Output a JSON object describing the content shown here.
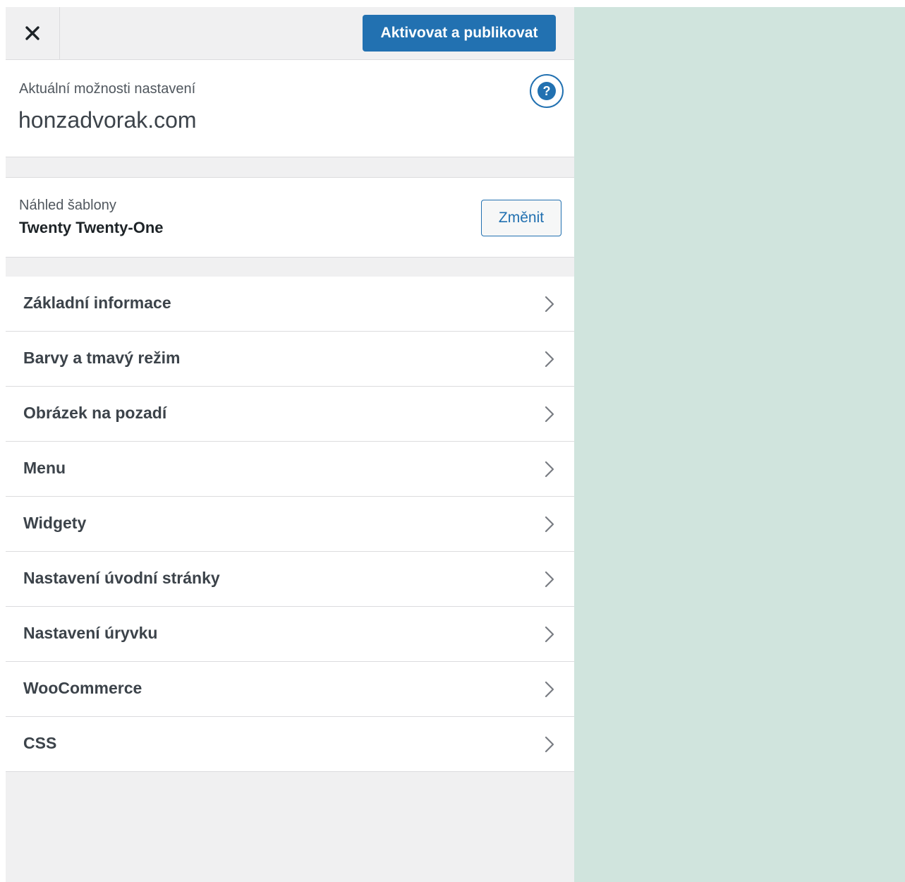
{
  "colors": {
    "accent": "#2271b1",
    "panel_bg": "#f0f0f1",
    "preview_bg": "#d0e4dd"
  },
  "header": {
    "close_icon": "close-icon",
    "publish_label": "Aktivovat a publikovat"
  },
  "info": {
    "label": "Aktuální možnosti nastavení",
    "site": "honzadvorak.com",
    "help_icon": "help-icon",
    "help_glyph": "?"
  },
  "theme": {
    "label": "Náhled šablony",
    "name": "Twenty Twenty-One",
    "change_label": "Změnit"
  },
  "menu": {
    "items": [
      {
        "label": "Základní informace"
      },
      {
        "label": "Barvy a tmavý režim"
      },
      {
        "label": "Obrázek na pozadí"
      },
      {
        "label": "Menu"
      },
      {
        "label": "Widgety"
      },
      {
        "label": "Nastavení úvodní stránky"
      },
      {
        "label": "Nastavení úryvku"
      },
      {
        "label": "WooCommerce"
      },
      {
        "label": "CSS"
      }
    ],
    "chevron_icon": "chevron-right-icon"
  }
}
